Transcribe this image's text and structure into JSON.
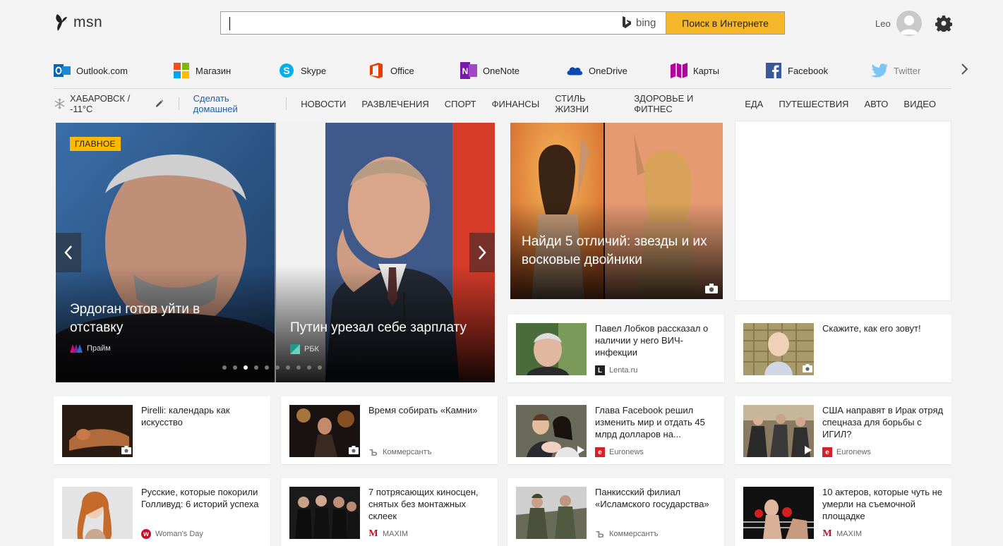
{
  "header": {
    "logo_text": "msn",
    "search_placeholder": "",
    "bing_label": "bing",
    "search_button": "Поиск в Интернете",
    "user_name": "Leo"
  },
  "apps": [
    {
      "label": "Outlook.com",
      "icon": "outlook-icon"
    },
    {
      "label": "Магазин",
      "icon": "store-icon"
    },
    {
      "label": "Skype",
      "icon": "skype-icon"
    },
    {
      "label": "Office",
      "icon": "office-icon"
    },
    {
      "label": "OneNote",
      "icon": "onenote-icon"
    },
    {
      "label": "OneDrive",
      "icon": "onedrive-icon"
    },
    {
      "label": "Карты",
      "icon": "maps-icon"
    },
    {
      "label": "Facebook",
      "icon": "facebook-icon"
    },
    {
      "label": "Twitter",
      "icon": "twitter-icon"
    }
  ],
  "nav": {
    "weather": "ХАБАРОВСК / -11°C",
    "make_home": "Сделать домашней",
    "items": [
      "НОВОСТИ",
      "РАЗВЛЕЧЕНИЯ",
      "СПОРТ",
      "ФИНАНСЫ",
      "СТИЛЬ ЖИЗНИ",
      "ЗДОРОВЬЕ И ФИТНЕС",
      "ЕДА",
      "ПУТЕШЕСТВИЯ",
      "АВТО",
      "ВИДЕО"
    ]
  },
  "hero": {
    "badge": "ГЛАВНОЕ",
    "slides": [
      {
        "title": "Эрдоган готов уйти в отставку",
        "source": "Прайм"
      },
      {
        "title": "Путин урезал себе зарплату",
        "source": "РБК"
      }
    ],
    "dot_count": 10,
    "active_dot": 3
  },
  "feature": {
    "title": "Найди 5 отличий: звезды и их восковые двойники"
  },
  "cards": [
    {
      "title": "Павел Лобков рассказал о наличии у него ВИЧ-инфекции",
      "source": "Lenta.ru",
      "src_color": "#222",
      "src_glyph": "L"
    },
    {
      "title": "Скажите, как его зовут!",
      "source": "",
      "src_color": "",
      "src_glyph": ""
    },
    {
      "title": "Pirelli: календарь как искусство",
      "source": "",
      "src_color": "",
      "src_glyph": ""
    },
    {
      "title": "Время собирать «Камни»",
      "source": "Коммерсантъ",
      "src_color": "#888",
      "src_glyph": "Ъ"
    },
    {
      "title": "Глава Facebook решил изменить мир и отдать 45 млрд долларов на...",
      "source": "Euronews",
      "src_color": "#d6202a",
      "src_glyph": "e"
    },
    {
      "title": "США направят в Ирак отряд спецназа для борьбы с ИГИЛ?",
      "source": "Euronews",
      "src_color": "#d6202a",
      "src_glyph": "e"
    },
    {
      "title": "Русские, которые покорили Голливуд: 6 историй успеха",
      "source": "Woman's Day",
      "src_color": "#c8102e",
      "src_glyph": "w"
    },
    {
      "title": "7 потрясающих киносцен, снятых без монтажных склеек",
      "source": "MAXIM",
      "src_color": "#c8102e",
      "src_glyph": "M"
    },
    {
      "title": "Панкисский филиал «Исламского государства»",
      "source": "Коммерсантъ",
      "src_color": "#888",
      "src_glyph": "Ъ"
    },
    {
      "title": "10 актеров, которые чуть не умерли на съемочной площадке",
      "source": "MAXIM",
      "src_color": "#c8102e",
      "src_glyph": "M"
    }
  ]
}
